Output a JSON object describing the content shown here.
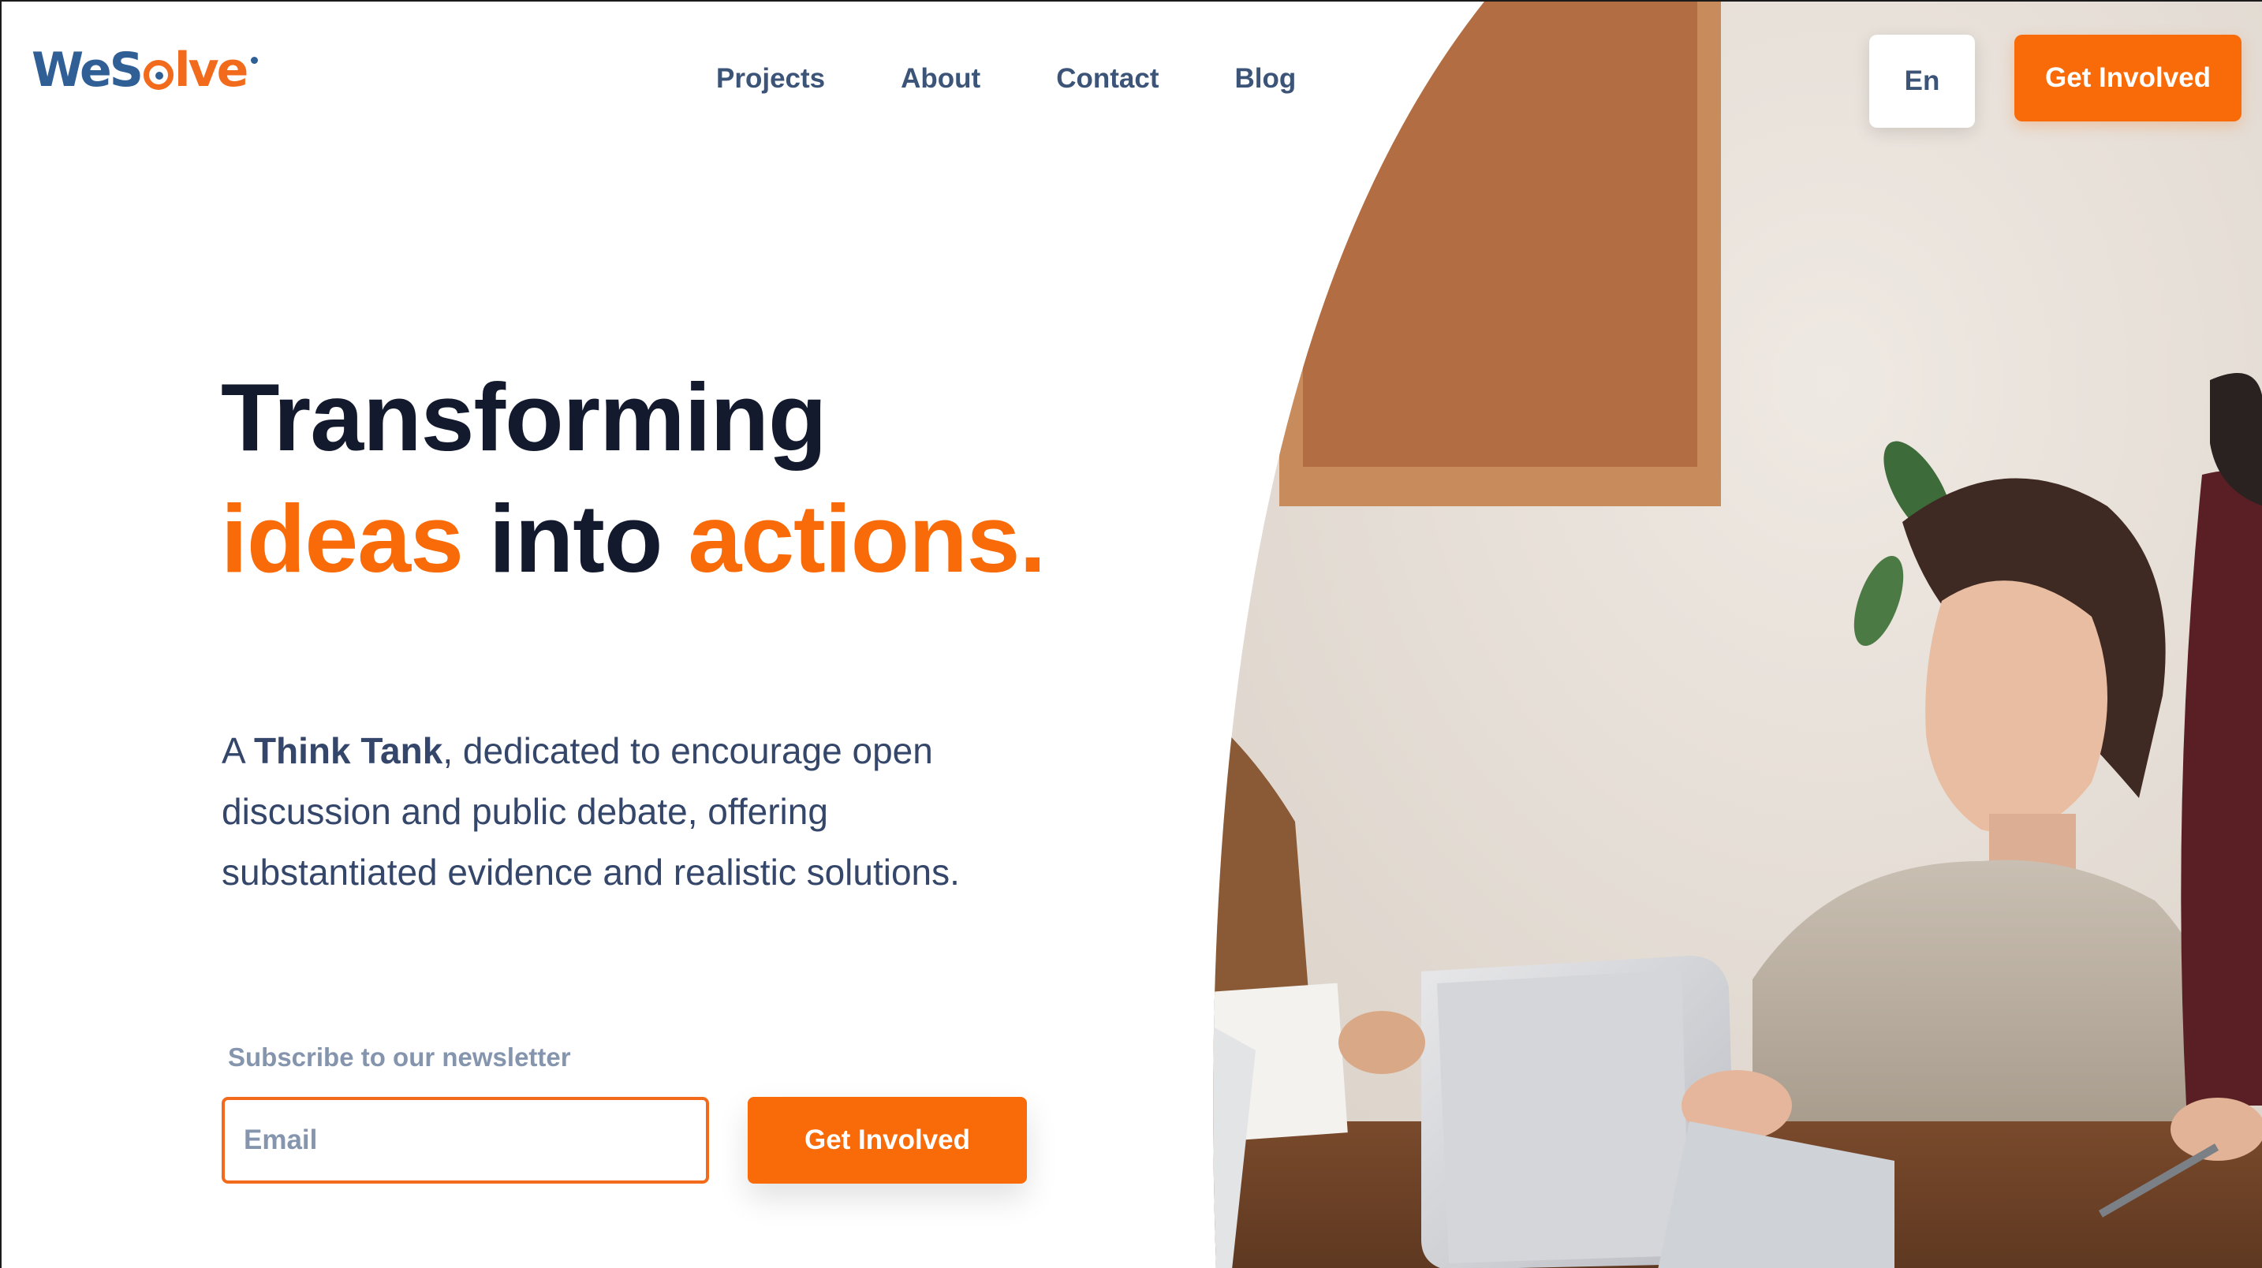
{
  "brand": {
    "logo_we": "We",
    "logo_s": "S",
    "logo_lve": "lve",
    "colors": {
      "primary": "#2f5f95",
      "accent": "#f96a08"
    }
  },
  "nav": {
    "items": [
      {
        "label": "Projects"
      },
      {
        "label": "About"
      },
      {
        "label": "Contact"
      },
      {
        "label": "Blog"
      }
    ]
  },
  "header": {
    "language": "En",
    "cta_label": "Get Involved"
  },
  "hero": {
    "headline_line1": "Transforming",
    "headline_word1": "ideas",
    "headline_word2": " into ",
    "headline_word3": "actions.",
    "description_prefix": "A ",
    "description_bold": "Think Tank",
    "description_rest": ", dedicated to encourage open discussion and public debate, offering substantiated evidence and realistic solutions.",
    "photo_icon": "hero-meeting-photo"
  },
  "newsletter": {
    "label": "Subscribe to our newsletter",
    "email_placeholder": "Email",
    "email_value": "",
    "button_label": "Get Involved"
  }
}
